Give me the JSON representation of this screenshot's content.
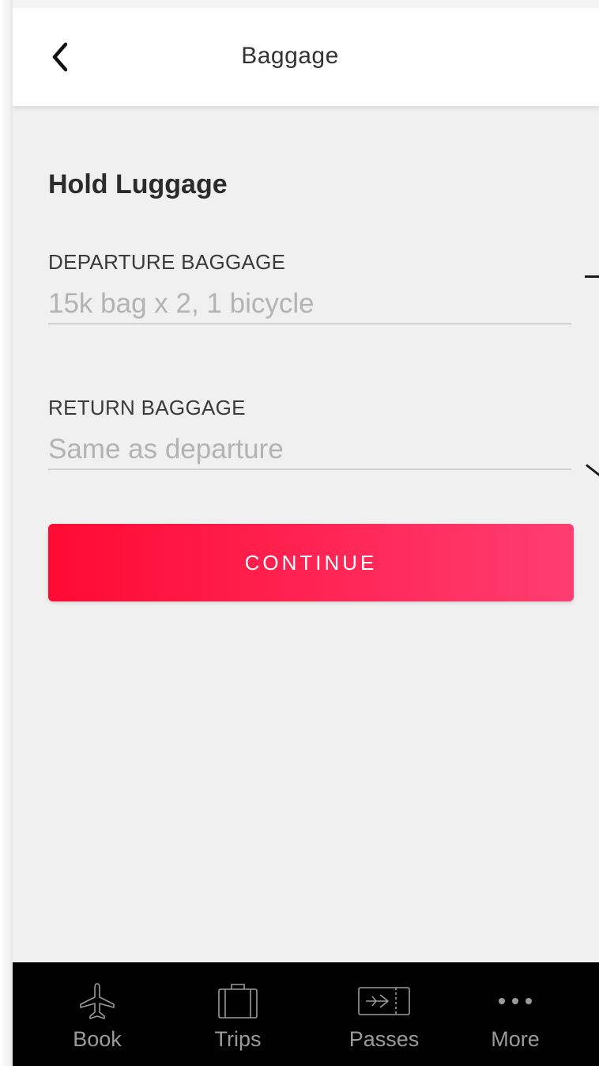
{
  "header": {
    "title": "Baggage",
    "back_icon": "chevron-left-icon"
  },
  "section": {
    "title": "Hold Luggage"
  },
  "fields": {
    "departure": {
      "label": "DEPARTURE BAGGAGE",
      "placeholder": "15k bag x 2, 1 bicycle"
    },
    "return": {
      "label": "RETURN BAGGAGE",
      "placeholder": "Same as departure"
    }
  },
  "continue_button": {
    "label": "CONTINUE"
  },
  "tabs": [
    {
      "label": "Book",
      "icon": "airplane-icon"
    },
    {
      "label": "Trips",
      "icon": "suitcase-icon"
    },
    {
      "label": "Passes",
      "icon": "boarding-pass-icon"
    },
    {
      "label": "More",
      "icon": "more-dots-icon"
    }
  ],
  "colors": {
    "accent_start": "#ff0a33",
    "accent_end": "#ff3d72",
    "tabbar_bg": "#000000",
    "tab_inactive": "#9a9a9a",
    "screen_bg": "#f0f0f0"
  }
}
